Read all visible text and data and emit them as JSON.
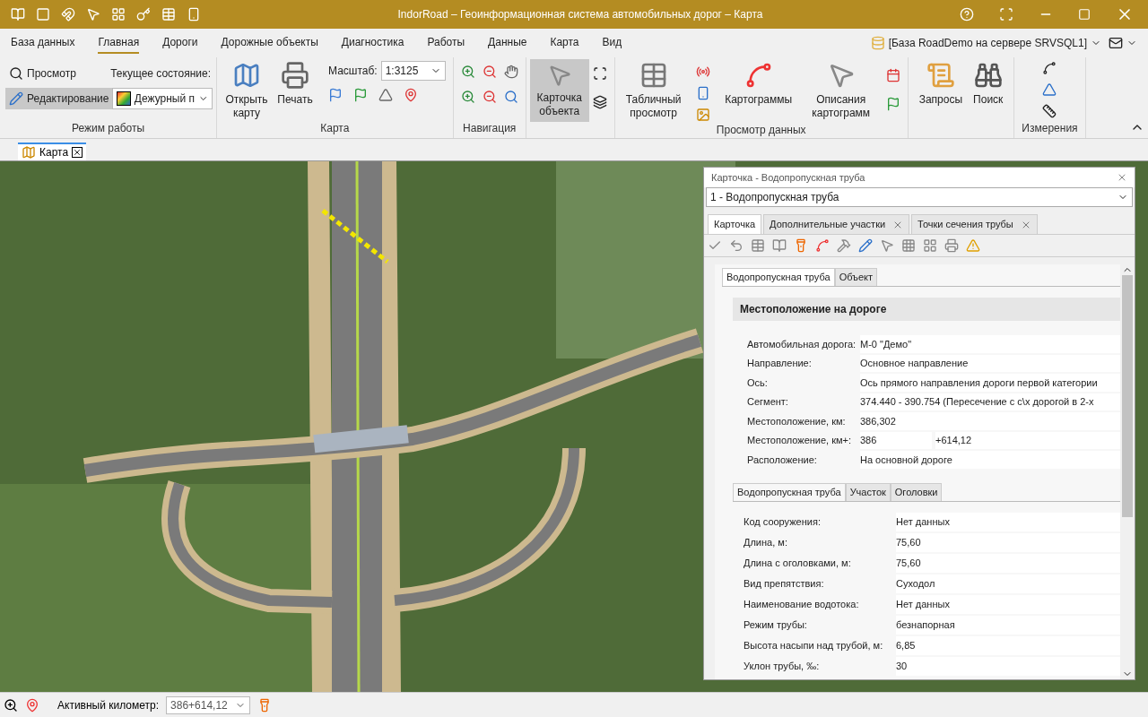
{
  "window": {
    "title": "IndorRoad – Геоинформационная система автомобильных дорог – Карта"
  },
  "menu_tabs": [
    {
      "label": "База данных",
      "selected": false
    },
    {
      "label": "Главная",
      "selected": true
    },
    {
      "label": "Дороги",
      "selected": false
    },
    {
      "label": "Дорожные объекты",
      "selected": false
    },
    {
      "label": "Диагностика",
      "selected": false
    },
    {
      "label": "Работы",
      "selected": false
    },
    {
      "label": "Данные",
      "selected": false
    },
    {
      "label": "Карта",
      "selected": false
    },
    {
      "label": "Вид",
      "selected": false
    }
  ],
  "database": "[База RoadDemo на сервере SRVSQL1]",
  "ribbon": {
    "mode": {
      "label": "Режим работы",
      "buttons": [
        {
          "label": "Просмотр",
          "selected": false
        },
        {
          "label": "Редактирование",
          "selected": true
        }
      ],
      "state_label": "Текущее состояние:",
      "state_value": "Дежурный п"
    },
    "map": {
      "label": "Карта",
      "open": "Открыть карту",
      "print": "Печать",
      "scale_label": "Масштаб:",
      "scale_value": "1:3125"
    },
    "navigation": {
      "label": "Навигация"
    },
    "card": {
      "label": "Карточка объекта",
      "selected": true
    },
    "data_view": {
      "label": "Просмотр данных",
      "table": "Табличный просмотр",
      "cartograms": "Картограммы",
      "descriptions": "Описания картограмм"
    },
    "queries": "Запросы",
    "search": "Поиск",
    "measure": {
      "label": "Измерения"
    }
  },
  "doc_tab": {
    "label": "Карта"
  },
  "card_panel": {
    "title": "Карточка - Водопропускная труба",
    "selector": "1 - Водопропускная труба",
    "tabs": [
      {
        "label": "Карточка",
        "selected": true,
        "closable": false
      },
      {
        "label": "Дополнительные участки",
        "selected": false,
        "closable": true
      },
      {
        "label": "Точки сечения трубы",
        "selected": false,
        "closable": true
      }
    ],
    "inner_tabs": [
      {
        "label": "Водопропускная труба",
        "selected": true
      },
      {
        "label": "Объект",
        "selected": false
      }
    ],
    "section_title": "Местоположение на дороге",
    "location_fields": [
      {
        "label": "Автомобильная дорога:",
        "value": "М-0 \"Демо\""
      },
      {
        "label": "Направление:",
        "value": "Основное направление"
      },
      {
        "label": "Ось:",
        "value": "Ось прямого направления дороги первой категории"
      },
      {
        "label": "Сегмент:",
        "value": "374.440 -    390.754 (Пересечение с с\\х дорогой в 2-х"
      },
      {
        "label": "Местоположение, км:",
        "value": "386,302"
      },
      {
        "label": "Местоположение, км+:",
        "value": "386",
        "value_2": "+614,12"
      },
      {
        "label": "Расположение:",
        "value": "На основной дороге"
      }
    ],
    "sub_tabs": [
      {
        "label": "Водопропускная труба",
        "selected": true
      },
      {
        "label": "Участок",
        "selected": false
      },
      {
        "label": "Оголовки",
        "selected": false
      }
    ],
    "pipe_fields": [
      {
        "label": "Код сооружения:",
        "value": "Нет данных"
      },
      {
        "label": "Длина, м:",
        "value": "75,60"
      },
      {
        "label": "Длина с оголовками, м:",
        "value": "75,60"
      },
      {
        "label": "Вид препятствия:",
        "value": "Суходол"
      },
      {
        "label": "Наименование водотока:",
        "value": "Нет данных"
      },
      {
        "label": "Режим трубы:",
        "value": "безнапорная"
      },
      {
        "label": "Высота насыпи над трубой, м:",
        "value": "6,85"
      },
      {
        "label": "Уклон трубы, ‰:",
        "value": "30"
      }
    ]
  },
  "status_bar": {
    "label": "Активный километр:",
    "value": "386+614,12"
  }
}
